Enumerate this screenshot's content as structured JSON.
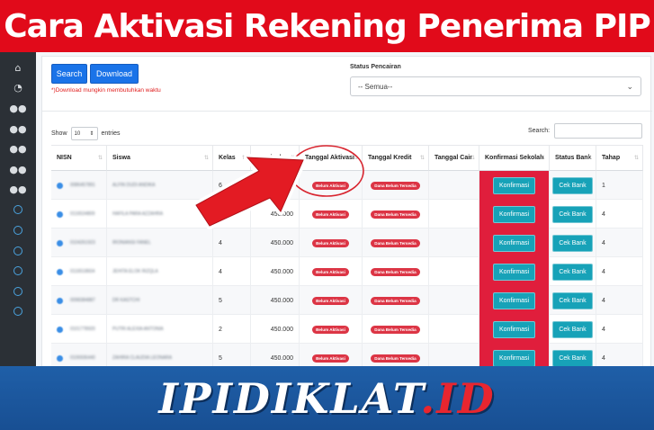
{
  "banner": {
    "title": "Cara Aktivasi Rekening Penerima PIP"
  },
  "colors": {
    "banner_red": "#e10a1a",
    "confirm_red": "#e01e3c",
    "brand_blue": "#1f5fa8",
    "button_blue": "#1a73e8",
    "button_teal": "#17a2b8"
  },
  "sidebar": {
    "icons": [
      "home-icon",
      "dashboard-icon",
      "users-icon",
      "users-icon",
      "users-icon",
      "users-icon",
      "users-icon",
      "circle-icon",
      "circle-icon",
      "circle-icon",
      "circle-icon",
      "circle-icon",
      "circle-icon"
    ]
  },
  "toolbar": {
    "search_label": "Search",
    "download_label": "Download",
    "note": "*)Download mungkin membutuhkan waktu"
  },
  "filter": {
    "status_label": "Status Pencairan",
    "status_value": "-- Semua--"
  },
  "datatable": {
    "show_label": "Show",
    "entries_value": "10",
    "entries_label": "entries",
    "search_label": "Search:"
  },
  "table": {
    "headers": [
      "NISN",
      "Siswa",
      "Kelas",
      "Nominal",
      "Tanggal Aktivasi",
      "Tanggal Kredit",
      "Tanggal Cair",
      "Konfirmasi Sekolah",
      "Status Bank",
      "Tahap"
    ],
    "rows": [
      {
        "nisn": "0086457891",
        "siswa": "ALFIN DUDI ANDIKA",
        "kelas": "6",
        "nominal": "",
        "aktivasi": "Belum Aktivasi",
        "kredit": "Dana Belum Tersedia",
        "konfirmasi": "Konfirmasi",
        "bank": "Cek Bank",
        "tahap": "1"
      },
      {
        "nisn": "0116534809",
        "siswa": "HAFILA PARA AZZAHRA",
        "kelas": "",
        "nominal": "450.000",
        "aktivasi": "Belum Aktivasi",
        "kredit": "Dana Belum Tersedia",
        "konfirmasi": "Konfirmasi",
        "bank": "Cek Bank",
        "tahap": "4"
      },
      {
        "nisn": "0104261923",
        "siswa": "IRONIANSI FANEL",
        "kelas": "4",
        "nominal": "450.000",
        "aktivasi": "Belum Aktivasi",
        "kredit": "Dana Belum Tersedia",
        "konfirmasi": "Konfirmasi",
        "bank": "Cek Bank",
        "tahap": "4"
      },
      {
        "nisn": "0116518604",
        "siswa": "JEHITA ELOK RIZQLA",
        "kelas": "4",
        "nominal": "450.000",
        "aktivasi": "Belum Aktivasi",
        "kredit": "Dana Belum Tersedia",
        "konfirmasi": "Konfirmasi",
        "bank": "Cek Bank",
        "tahap": "4"
      },
      {
        "nisn": "0098384887",
        "siswa": "DR KASTCHI",
        "kelas": "5",
        "nominal": "450.000",
        "aktivasi": "Belum Aktivasi",
        "kredit": "Dana Belum Tersedia",
        "konfirmasi": "Konfirmasi",
        "bank": "Cek Bank",
        "tahap": "4"
      },
      {
        "nisn": "0101778920",
        "siswa": "PUTRI ALEXIA ANTONIA",
        "kelas": "2",
        "nominal": "450.000",
        "aktivasi": "Belum Aktivasi",
        "kredit": "Dana Belum Tersedia",
        "konfirmasi": "Konfirmasi",
        "bank": "Cek Bank",
        "tahap": "4"
      },
      {
        "nisn": "0106936440",
        "siswa": "ZAHIRA CLAUDIA LEONARA",
        "kelas": "5",
        "nominal": "450.000",
        "aktivasi": "Belum Aktivasi",
        "kredit": "Dana Belum Tersedia",
        "konfirmasi": "Konfirmasi",
        "bank": "Cek Bank",
        "tahap": "4"
      }
    ]
  },
  "brand": {
    "name": "IPIDIKLAT",
    "suffix": ".ID"
  }
}
